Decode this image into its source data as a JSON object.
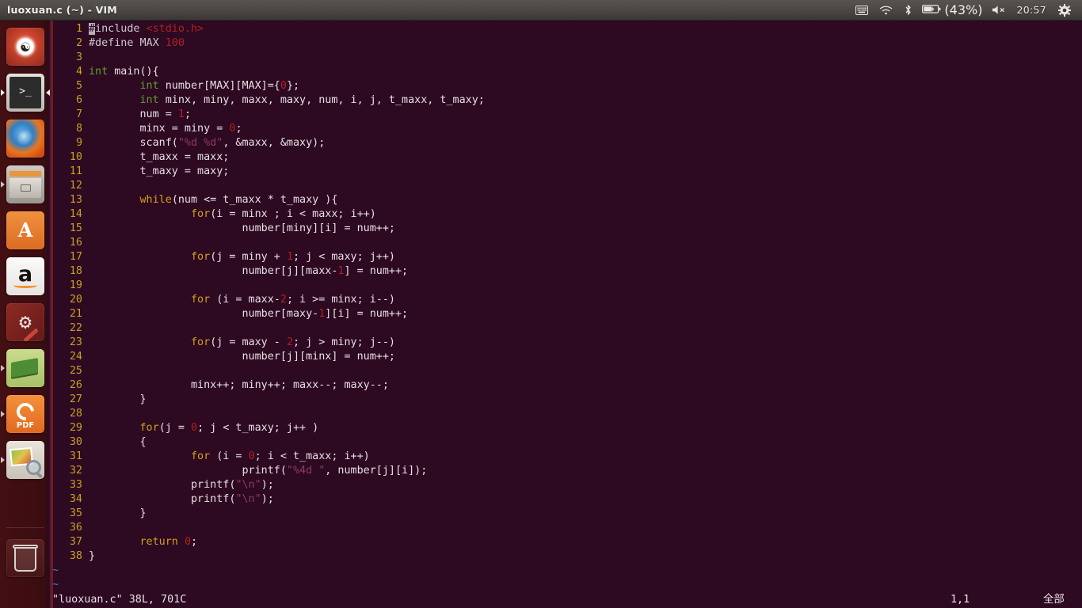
{
  "panel": {
    "title": "luoxuan.c (~) - VIM",
    "tray": {
      "keyboard_icon": "keyboard-icon",
      "wifi_icon": "wifi-icon",
      "bluetooth_icon": "bluetooth-icon",
      "battery_icon": "battery-icon",
      "battery_label": "(43%)",
      "volume_icon": "volume-muted-icon",
      "clock": "20:57",
      "gear_icon": "gear-icon"
    }
  },
  "launcher": {
    "items": [
      {
        "name": "ubuntu-dash",
        "label": "Dash home",
        "running": false
      },
      {
        "name": "terminal",
        "label": "Terminal",
        "running": true,
        "focused": true
      },
      {
        "name": "firefox",
        "label": "Firefox Web Browser",
        "running": false
      },
      {
        "name": "files",
        "label": "Files",
        "running": true,
        "focused": false
      },
      {
        "name": "ubuntu-software",
        "label": "Ubuntu Software",
        "running": false
      },
      {
        "name": "amazon",
        "label": "Amazon",
        "running": false
      },
      {
        "name": "system-settings",
        "label": "System Settings",
        "running": false
      },
      {
        "name": "dictionary",
        "label": "Dictionary",
        "running": true,
        "focused": false
      },
      {
        "name": "foxit-pdf-reader",
        "label": "Foxit Reader",
        "running": true,
        "focused": false
      },
      {
        "name": "image-viewer",
        "label": "Image Viewer",
        "running": true,
        "focused": false
      },
      {
        "name": "trash",
        "label": "Trash",
        "running": false
      }
    ]
  },
  "editor": {
    "colors": {
      "background": "#2d0922",
      "line_number": "#c8a020",
      "keyword_type": "#5f9e2f",
      "keyword_statement": "#d4a017",
      "number_literal": "#b02020",
      "string_literal": "#8e3a63",
      "preprocessor": "#cfc6cb",
      "text": "#e8e0e4"
    },
    "lines": [
      {
        "n": "1",
        "tokens": [
          {
            "t": "#include ",
            "c": "pre",
            "cursor_on_first": true
          },
          {
            "t": "<stdio.h>",
            "c": "inc"
          }
        ]
      },
      {
        "n": "2",
        "tokens": [
          {
            "t": "#define MAX ",
            "c": "pre"
          },
          {
            "t": "100",
            "c": "num"
          }
        ]
      },
      {
        "n": "3",
        "tokens": []
      },
      {
        "n": "4",
        "tokens": [
          {
            "t": "int",
            "c": "kw"
          },
          {
            "t": " main(){",
            "c": ""
          }
        ]
      },
      {
        "n": "5",
        "tokens": [
          {
            "t": "        ",
            "c": ""
          },
          {
            "t": "int",
            "c": "kw"
          },
          {
            "t": " number[MAX][MAX]={",
            "c": ""
          },
          {
            "t": "0",
            "c": "num"
          },
          {
            "t": "};",
            "c": ""
          }
        ]
      },
      {
        "n": "6",
        "tokens": [
          {
            "t": "        ",
            "c": ""
          },
          {
            "t": "int",
            "c": "kw"
          },
          {
            "t": " minx, miny, maxx, maxy, num, i, j, t_maxx, t_maxy;",
            "c": ""
          }
        ]
      },
      {
        "n": "7",
        "tokens": [
          {
            "t": "        num = ",
            "c": ""
          },
          {
            "t": "1",
            "c": "num"
          },
          {
            "t": ";",
            "c": ""
          }
        ]
      },
      {
        "n": "8",
        "tokens": [
          {
            "t": "        minx = miny = ",
            "c": ""
          },
          {
            "t": "0",
            "c": "num"
          },
          {
            "t": ";",
            "c": ""
          }
        ]
      },
      {
        "n": "9",
        "tokens": [
          {
            "t": "        scanf(",
            "c": ""
          },
          {
            "t": "\"%d %d\"",
            "c": "str"
          },
          {
            "t": ", &maxx, &maxy);",
            "c": ""
          }
        ]
      },
      {
        "n": "10",
        "tokens": [
          {
            "t": "        t_maxx = maxx;",
            "c": ""
          }
        ]
      },
      {
        "n": "11",
        "tokens": [
          {
            "t": "        t_maxy = maxy;",
            "c": ""
          }
        ]
      },
      {
        "n": "12",
        "tokens": []
      },
      {
        "n": "13",
        "tokens": [
          {
            "t": "        ",
            "c": ""
          },
          {
            "t": "while",
            "c": "stmt"
          },
          {
            "t": "(num <= t_maxx * t_maxy ){",
            "c": ""
          }
        ]
      },
      {
        "n": "14",
        "tokens": [
          {
            "t": "                ",
            "c": ""
          },
          {
            "t": "for",
            "c": "stmt"
          },
          {
            "t": "(i = minx ; i < maxx; i++)",
            "c": ""
          }
        ]
      },
      {
        "n": "15",
        "tokens": [
          {
            "t": "                        number[miny][i] = num++;",
            "c": ""
          }
        ]
      },
      {
        "n": "16",
        "tokens": []
      },
      {
        "n": "17",
        "tokens": [
          {
            "t": "                ",
            "c": ""
          },
          {
            "t": "for",
            "c": "stmt"
          },
          {
            "t": "(j = miny + ",
            "c": ""
          },
          {
            "t": "1",
            "c": "num"
          },
          {
            "t": "; j < maxy; j++)",
            "c": ""
          }
        ]
      },
      {
        "n": "18",
        "tokens": [
          {
            "t": "                        number[j][maxx-",
            "c": ""
          },
          {
            "t": "1",
            "c": "num"
          },
          {
            "t": "] = num++;",
            "c": ""
          }
        ]
      },
      {
        "n": "19",
        "tokens": []
      },
      {
        "n": "20",
        "tokens": [
          {
            "t": "                ",
            "c": ""
          },
          {
            "t": "for",
            "c": "stmt"
          },
          {
            "t": " (i = maxx-",
            "c": ""
          },
          {
            "t": "2",
            "c": "num"
          },
          {
            "t": "; i >= minx; i--)",
            "c": ""
          }
        ]
      },
      {
        "n": "21",
        "tokens": [
          {
            "t": "                        number[maxy-",
            "c": ""
          },
          {
            "t": "1",
            "c": "num"
          },
          {
            "t": "][i] = num++;",
            "c": ""
          }
        ]
      },
      {
        "n": "22",
        "tokens": []
      },
      {
        "n": "23",
        "tokens": [
          {
            "t": "                ",
            "c": ""
          },
          {
            "t": "for",
            "c": "stmt"
          },
          {
            "t": "(j = maxy - ",
            "c": ""
          },
          {
            "t": "2",
            "c": "num"
          },
          {
            "t": "; j > miny; j--)",
            "c": ""
          }
        ]
      },
      {
        "n": "24",
        "tokens": [
          {
            "t": "                        number[j][minx] = num++;",
            "c": ""
          }
        ]
      },
      {
        "n": "25",
        "tokens": []
      },
      {
        "n": "26",
        "tokens": [
          {
            "t": "                minx++; miny++; maxx--; maxy--;",
            "c": ""
          }
        ]
      },
      {
        "n": "27",
        "tokens": [
          {
            "t": "        }",
            "c": ""
          }
        ]
      },
      {
        "n": "28",
        "tokens": []
      },
      {
        "n": "29",
        "tokens": [
          {
            "t": "        ",
            "c": ""
          },
          {
            "t": "for",
            "c": "stmt"
          },
          {
            "t": "(j = ",
            "c": ""
          },
          {
            "t": "0",
            "c": "num"
          },
          {
            "t": "; j < t_maxy; j++ )",
            "c": ""
          }
        ]
      },
      {
        "n": "30",
        "tokens": [
          {
            "t": "        {",
            "c": ""
          }
        ]
      },
      {
        "n": "31",
        "tokens": [
          {
            "t": "                ",
            "c": ""
          },
          {
            "t": "for",
            "c": "stmt"
          },
          {
            "t": " (i = ",
            "c": ""
          },
          {
            "t": "0",
            "c": "num"
          },
          {
            "t": "; i < t_maxx; i++)",
            "c": ""
          }
        ]
      },
      {
        "n": "32",
        "tokens": [
          {
            "t": "                        printf(",
            "c": ""
          },
          {
            "t": "\"%4d \"",
            "c": "str"
          },
          {
            "t": ", number[j][i]);",
            "c": ""
          }
        ]
      },
      {
        "n": "33",
        "tokens": [
          {
            "t": "                printf(",
            "c": ""
          },
          {
            "t": "\"\\n\"",
            "c": "str"
          },
          {
            "t": ");",
            "c": ""
          }
        ]
      },
      {
        "n": "34",
        "tokens": [
          {
            "t": "                printf(",
            "c": ""
          },
          {
            "t": "\"\\n\"",
            "c": "str"
          },
          {
            "t": ");",
            "c": ""
          }
        ]
      },
      {
        "n": "35",
        "tokens": [
          {
            "t": "        }",
            "c": ""
          }
        ]
      },
      {
        "n": "36",
        "tokens": []
      },
      {
        "n": "37",
        "tokens": [
          {
            "t": "        ",
            "c": ""
          },
          {
            "t": "return",
            "c": "stmt"
          },
          {
            "t": " ",
            "c": ""
          },
          {
            "t": "0",
            "c": "num"
          },
          {
            "t": ";",
            "c": ""
          }
        ]
      },
      {
        "n": "38",
        "tokens": [
          {
            "t": "}",
            "c": ""
          }
        ]
      }
    ],
    "filler_rows": [
      "~",
      "~"
    ],
    "statusline": {
      "file_info": "\"luoxuan.c\" 38L, 701C",
      "cursor_position": "1,1",
      "scroll_indicator": "全部"
    }
  }
}
